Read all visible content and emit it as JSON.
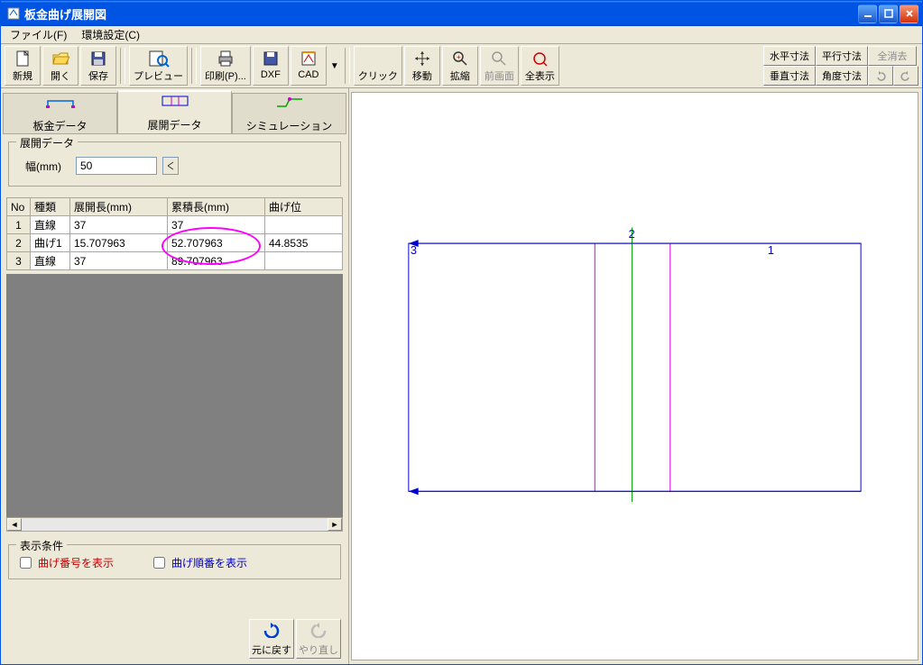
{
  "window": {
    "title": "板金曲げ展開図"
  },
  "menu": {
    "file": "ファイル(F)",
    "env": "環境設定(C)"
  },
  "toolbar": {
    "new": "新規",
    "open": "開く",
    "save": "保存",
    "preview": "プレビュー",
    "print": "印刷(P)...",
    "dxf": "DXF",
    "cad": "CAD",
    "click": "クリック",
    "move": "移動",
    "zoom": "拡縮",
    "prev": "前画面",
    "all": "全表示",
    "dim_h": "水平寸法",
    "dim_p": "平行寸法",
    "clear_all": "全消去",
    "dim_v": "垂直寸法",
    "dim_a": "角度寸法"
  },
  "tabs": {
    "sheet": "板金データ",
    "develop": "展開データ",
    "sim": "シミュレーション"
  },
  "develop": {
    "group_title": "展開データ",
    "width_label": "幅(mm)",
    "width_value": "50"
  },
  "table": {
    "headers": [
      "No",
      "種類",
      "展開長(mm)",
      "累積長(mm)",
      "曲げ位"
    ],
    "rows": [
      {
        "no": "1",
        "type": "直線",
        "len": "37",
        "cum": "37",
        "bend": ""
      },
      {
        "no": "2",
        "type": "曲げ1",
        "len": "15.707963",
        "cum": "52.707963",
        "bend": "44.8535"
      },
      {
        "no": "3",
        "type": "直線",
        "len": "37",
        "cum": "89.707963",
        "bend": ""
      }
    ]
  },
  "conditions": {
    "title": "表示条件",
    "show_bend_no": "曲げ番号を表示",
    "show_bend_order": "曲げ順番を表示"
  },
  "bottom_buttons": {
    "undo": "元に戻す",
    "redo": "やり直し"
  },
  "drawing": {
    "labels": {
      "left": "3",
      "mid": "2",
      "right": "1"
    }
  }
}
